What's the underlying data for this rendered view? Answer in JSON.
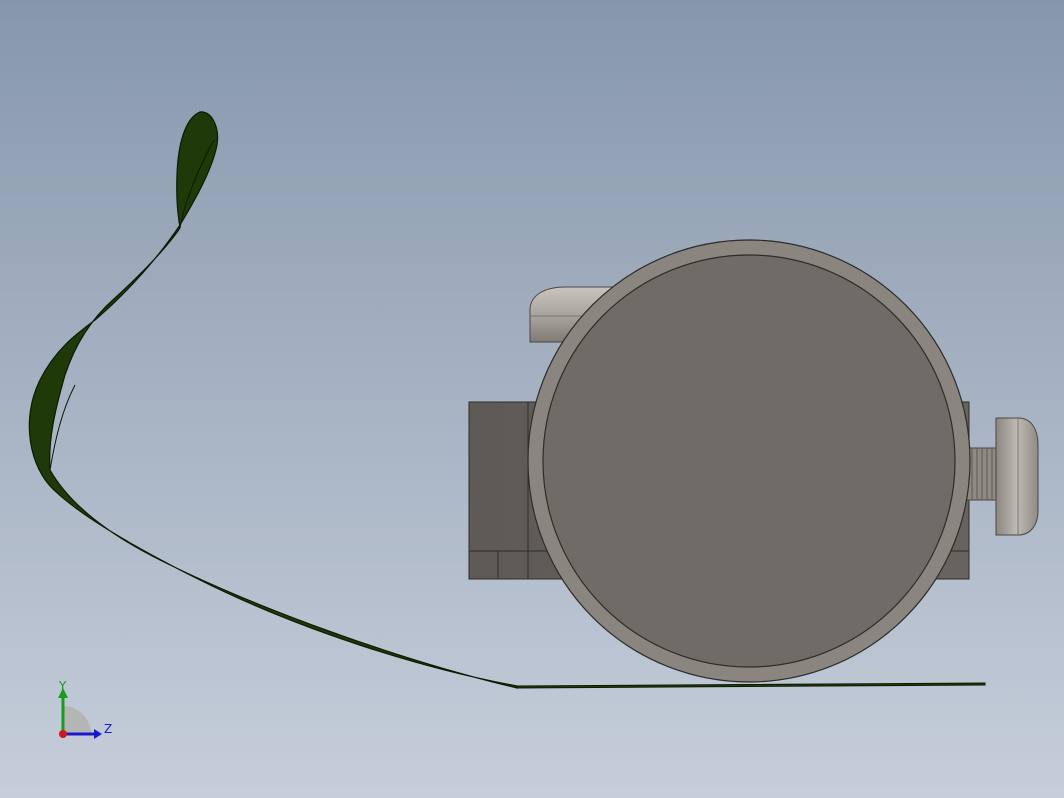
{
  "view": {
    "background_top": "#8797ab",
    "background_bottom": "#c6ceda"
  },
  "model": {
    "belt_color": "#1f3a08",
    "belt_edge_color": "#0c1a02",
    "body_color": "#6f6b66",
    "body_rim_color": "#8a857f",
    "knob_color": "#a9a49d"
  },
  "triad": {
    "y_label": "Y",
    "z_label": "Z",
    "y_color": "#1a9a1a",
    "z_color": "#1a1acc",
    "x_color": "#cc1a1a"
  }
}
